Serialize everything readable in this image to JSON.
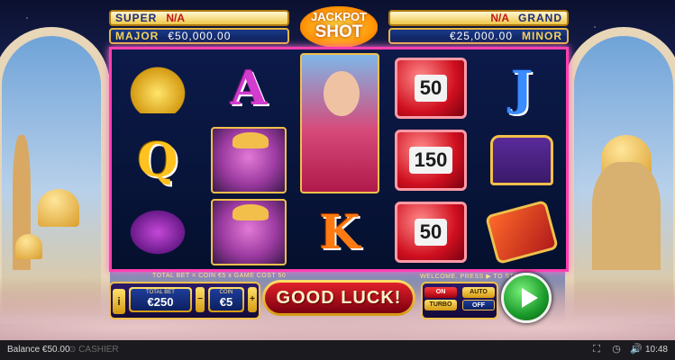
{
  "jackpots": {
    "super": {
      "name": "SUPER",
      "value": "N/A"
    },
    "major": {
      "name": "MAJOR",
      "value": "€50,000.00"
    },
    "grand": {
      "name": "GRAND",
      "value": "N/A"
    },
    "minor": {
      "name": "MINOR",
      "value": "€25,000.00"
    }
  },
  "logo": {
    "line1": "JACKPOT",
    "line2": "SHOT"
  },
  "reels": {
    "r1": [
      {
        "symbol": "lamp"
      },
      {
        "symbol": "Q"
      },
      {
        "symbol": "pillow"
      }
    ],
    "r2": [
      {
        "symbol": "A"
      },
      {
        "symbol": "genie"
      },
      {
        "symbol": "genie"
      }
    ],
    "r3": [
      {
        "symbol": "princess"
      },
      {
        "symbol": "K"
      }
    ],
    "r4": [
      {
        "symbol": "gem",
        "value": "50"
      },
      {
        "symbol": "gem",
        "value": "150"
      },
      {
        "symbol": "gem",
        "value": "50"
      }
    ],
    "r5": [
      {
        "symbol": "J"
      },
      {
        "symbol": "chest"
      },
      {
        "symbol": "carpet"
      }
    ]
  },
  "controls": {
    "bet_info": "TOTAL BET = COIN €5 x GAME COST 50",
    "welcome": "WELCOME. PRESS ▶ TO START",
    "info_button": "i",
    "total_bet_label": "TOTAL BET",
    "total_bet_value": "€250",
    "coin_label": "COIN",
    "coin_value": "€5",
    "minus": "−",
    "plus": "+",
    "message": "GOOD LUCK!",
    "turbo_on": "ON",
    "turbo_label": "TURBO",
    "auto_label": "AUTO",
    "auto_off": "OFF"
  },
  "status": {
    "balance_label": "Balance",
    "balance_value": "€50.00",
    "cashier": "CASHIER",
    "time": "10:48",
    "icons": [
      "fullscreen-icon",
      "history-icon",
      "sound-icon"
    ]
  }
}
